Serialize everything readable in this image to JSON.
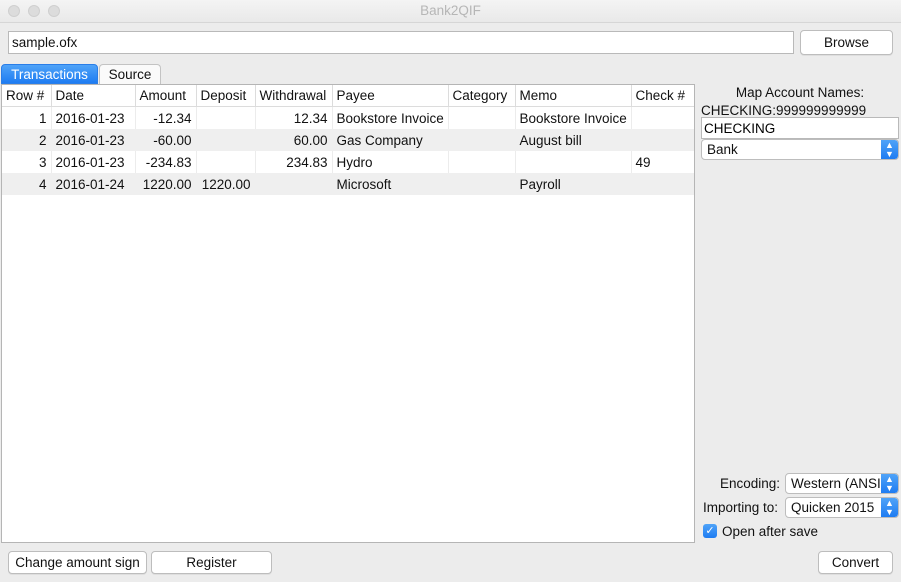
{
  "window": {
    "title": "Bank2QIF"
  },
  "file": {
    "path": "sample.ofx",
    "browse_label": "Browse"
  },
  "tabs": [
    {
      "label": "Transactions",
      "active": true
    },
    {
      "label": "Source",
      "active": false
    }
  ],
  "table": {
    "columns": [
      "Row #",
      "Date",
      "Amount",
      "Deposit",
      "Withdrawal",
      "Payee",
      "Category",
      "Memo",
      "Check #"
    ],
    "rows": [
      [
        "1",
        "2016-01-23",
        "-12.34",
        "",
        "12.34",
        "Bookstore Invoice",
        "",
        "Bookstore Invoice",
        ""
      ],
      [
        "2",
        "2016-01-23",
        "-60.00",
        "",
        "60.00",
        "Gas Company",
        "",
        "August bill",
        ""
      ],
      [
        "3",
        "2016-01-23",
        "-234.83",
        "",
        "234.83",
        "Hydro",
        "",
        "",
        "49"
      ],
      [
        "4",
        "2016-01-24",
        "1220.00",
        "1220.00",
        "",
        "Microsoft",
        "",
        "Payroll",
        ""
      ]
    ]
  },
  "sidebar": {
    "map_title": "Map Account Names:",
    "account_id": "CHECKING:999999999999",
    "account_name": "CHECKING",
    "account_type": "Bank",
    "encoding_label": "Encoding:",
    "encoding_value": "Western (ANSI)",
    "importing_label": "Importing to:",
    "importing_value": "Quicken 2015",
    "open_after_save_label": "Open after save",
    "open_after_save": true
  },
  "footer": {
    "change_sign_label": "Change amount sign",
    "register_label": "Register",
    "convert_label": "Convert"
  },
  "colors": {
    "accent": "#2a7ee8",
    "row_alt": "#efefef"
  },
  "icons": {
    "select_arrows": "updown-chevron-icon",
    "check": "checkmark-icon"
  }
}
